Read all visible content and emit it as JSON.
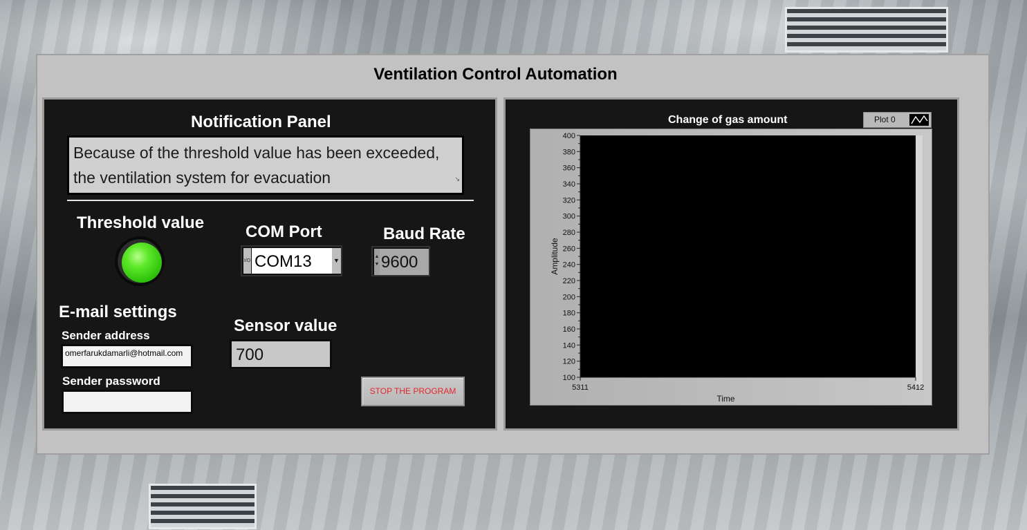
{
  "app": {
    "title": "Ventilation Control Automation"
  },
  "notification": {
    "heading": "Notification Panel",
    "message": "Because of the threshold value has been exceeded, the ventilation system for evacuation"
  },
  "threshold": {
    "label": "Threshold value",
    "led_state": "on",
    "led_color": "#3ddc14"
  },
  "com_port": {
    "label": "COM Port",
    "io_glyph": "I/O",
    "value": "COM13"
  },
  "baud_rate": {
    "label": "Baud Rate",
    "value": "9600"
  },
  "email": {
    "heading": "E-mail settings",
    "sender_address_label": "Sender address",
    "sender_address_value": "omerfarukdamarli@hotmail.com",
    "sender_password_label": "Sender password",
    "sender_password_value": ""
  },
  "sensor": {
    "label": "Sensor value",
    "value": "700"
  },
  "controls": {
    "stop_label": "STOP THE PROGRAM",
    "stop_color": "#e2262a"
  },
  "chart_data": {
    "type": "line",
    "title": "Change of gas amount",
    "xlabel": "Time",
    "ylabel": "Amplitude",
    "xlim": [
      5311,
      5412
    ],
    "ylim": [
      100,
      400
    ],
    "x_tick_labels": [
      "5311",
      "5412"
    ],
    "y_tick_labels": [
      "100",
      "120",
      "140",
      "160",
      "180",
      "200",
      "220",
      "240",
      "260",
      "280",
      "300",
      "320",
      "340",
      "360",
      "380",
      "400"
    ],
    "legend": "top-right",
    "legend_entries": [
      "Plot 0"
    ],
    "series": [
      {
        "name": "Plot 0",
        "values": []
      }
    ],
    "plot_background": "#000000",
    "grid": false
  }
}
